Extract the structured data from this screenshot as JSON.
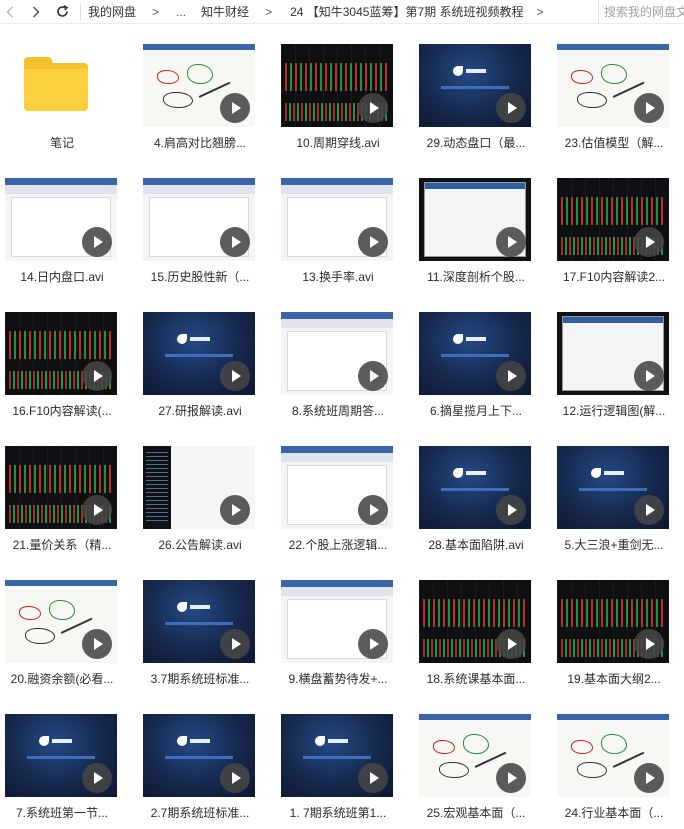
{
  "topbar": {
    "breadcrumbs": [
      "我的网盘",
      "知牛财经",
      "24 【知牛3045蓝筹】第7期 系统班视频教程"
    ],
    "ellipsis": "...",
    "arrow": ">",
    "search_placeholder": "搜索我的网盘文件"
  },
  "colors": {
    "folder": "#fbd03f",
    "play_button": "#464646",
    "accent": "#3a66a8"
  },
  "icons": {
    "back": "chevron-left-icon",
    "forward": "chevron-right-icon",
    "refresh": "refresh-icon",
    "play": "play-icon",
    "folder": "folder-icon"
  },
  "items": [
    {
      "label": "笔记",
      "kind": "folder"
    },
    {
      "label": "4.肩高对比翘膀...",
      "kind": "video",
      "style": "doodle"
    },
    {
      "label": "10.周期穿线.avi",
      "kind": "video",
      "style": "dark"
    },
    {
      "label": "29.动态盘口（最...",
      "kind": "video",
      "style": "blue"
    },
    {
      "label": "23.估值模型（解...",
      "kind": "video",
      "style": "doodle"
    },
    {
      "label": "14.日内盘口.avi",
      "kind": "video",
      "style": "white"
    },
    {
      "label": "15.历史股性新（...",
      "kind": "video",
      "style": "white"
    },
    {
      "label": "13.换手率.avi",
      "kind": "video",
      "style": "white"
    },
    {
      "label": "11.深度剖析个股...",
      "kind": "video",
      "style": "framed"
    },
    {
      "label": "17.F10内容解读2...",
      "kind": "video",
      "style": "dark"
    },
    {
      "label": "16.F10内容解读(...",
      "kind": "video",
      "style": "dark"
    },
    {
      "label": "27.研报解读.avi",
      "kind": "video",
      "style": "blue"
    },
    {
      "label": "8.系统班周期答...",
      "kind": "video",
      "style": "white"
    },
    {
      "label": "6.摘星揽月上下...",
      "kind": "video",
      "style": "blue"
    },
    {
      "label": "12.运行逻辑图(解...",
      "kind": "video",
      "style": "framed"
    },
    {
      "label": "21.量价关系（精...",
      "kind": "video",
      "style": "dark"
    },
    {
      "label": "26.公告解读.avi",
      "kind": "video",
      "style": "mixed"
    },
    {
      "label": "22.个股上涨逻辑...",
      "kind": "video",
      "style": "white"
    },
    {
      "label": "28.基本面陷阱.avi",
      "kind": "video",
      "style": "blue"
    },
    {
      "label": "5.大三浪+重剑无...",
      "kind": "video",
      "style": "blue"
    },
    {
      "label": "20.融资余额(必看...",
      "kind": "video",
      "style": "doodle"
    },
    {
      "label": "3.7期系统班标准...",
      "kind": "video",
      "style": "blue"
    },
    {
      "label": "9.横盘蓄势待发+...",
      "kind": "video",
      "style": "white"
    },
    {
      "label": "18.系统课基本面...",
      "kind": "video",
      "style": "dark"
    },
    {
      "label": "19.基本面大纲2...",
      "kind": "video",
      "style": "dark"
    },
    {
      "label": "7.系统班第一节...",
      "kind": "video",
      "style": "blue"
    },
    {
      "label": "2.7期系统班标准...",
      "kind": "video",
      "style": "blue"
    },
    {
      "label": "1. 7期系统班第1...",
      "kind": "video",
      "style": "blue"
    },
    {
      "label": "25.宏观基本面（...",
      "kind": "video",
      "style": "doodle"
    },
    {
      "label": "24.行业基本面（...",
      "kind": "video",
      "style": "doodle"
    }
  ]
}
